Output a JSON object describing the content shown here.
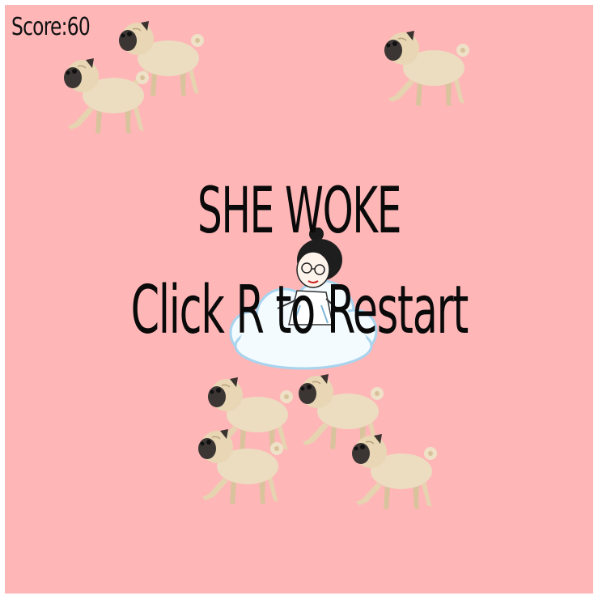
{
  "hud": {
    "score_text": "Score:60"
  },
  "overlay": {
    "line1": "SHE WOKE",
    "line2": "Click R to Restart"
  },
  "colors": {
    "background": "#ffb6b7",
    "border": "#ffffff",
    "text": "#0a0a0a"
  },
  "sprites": {
    "enemy": "pug-sprite",
    "player": "girl-on-cloud-sprite",
    "enemy_count": 7
  }
}
